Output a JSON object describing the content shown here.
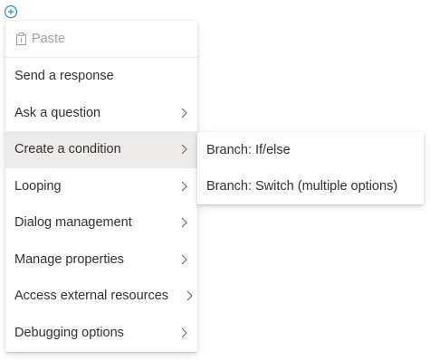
{
  "canvas": {
    "add_button_icon": "plus-circle-icon",
    "accent_color": "#0078d4"
  },
  "main_menu": {
    "paste": {
      "label": "Paste",
      "icon": "clipboard-icon",
      "disabled": true
    },
    "items": [
      {
        "label": "Send a response",
        "has_submenu": false
      },
      {
        "label": "Ask a question",
        "has_submenu": true
      },
      {
        "label": "Create a condition",
        "has_submenu": true,
        "active": true
      },
      {
        "label": "Looping",
        "has_submenu": true
      },
      {
        "label": "Dialog management",
        "has_submenu": true
      },
      {
        "label": "Manage properties",
        "has_submenu": true
      },
      {
        "label": "Access external resources",
        "has_submenu": true
      },
      {
        "label": "Debugging options",
        "has_submenu": true
      }
    ]
  },
  "submenu": {
    "items": [
      {
        "label": "Branch: If/else"
      },
      {
        "label": "Branch: Switch (multiple options)"
      }
    ]
  },
  "colors": {
    "active_bg": "#edebe9",
    "text": "#323130",
    "disabled_text": "#a19f9d",
    "chevron": "#605e5c"
  }
}
